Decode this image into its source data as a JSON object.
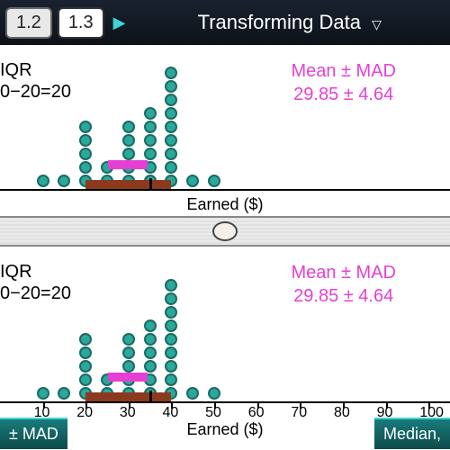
{
  "topbar": {
    "tabs": [
      "1.2",
      "1.3"
    ],
    "active_tab": 1,
    "title": "Transforming Data"
  },
  "chart_data": [
    {
      "type": "dotplot",
      "title_left_line1": "IQR",
      "title_left_line2": "0−20=20",
      "title_right_line1": "Mean ± MAD",
      "title_right_line2": "29.85 ± 4.64",
      "xlabel": "Earned ($)",
      "xlim": [
        0,
        105
      ],
      "stacks": [
        {
          "x": 10,
          "count": 1
        },
        {
          "x": 15,
          "count": 1
        },
        {
          "x": 20,
          "count": 5
        },
        {
          "x": 25,
          "count": 2
        },
        {
          "x": 30,
          "count": 5
        },
        {
          "x": 35,
          "count": 6
        },
        {
          "x": 40,
          "count": 9
        },
        {
          "x": 45,
          "count": 1
        },
        {
          "x": 50,
          "count": 1
        }
      ],
      "iqr_box": {
        "from": 20,
        "to": 40
      },
      "mad_box": {
        "from": 25.21,
        "to": 34.49
      },
      "median_mark": 35,
      "mean_mark": 29.85
    },
    {
      "type": "dotplot",
      "title_left_line1": "IQR",
      "title_left_line2": "0−20=20",
      "title_right_line1": "Mean ± MAD",
      "title_right_line2": "29.85 ± 4.64",
      "xlabel": "Earned ($)",
      "xlim": [
        0,
        105
      ],
      "ticks": [
        "10",
        "20",
        "30",
        "40",
        "50",
        "60",
        "70",
        "80",
        "90",
        "100"
      ],
      "stacks": [
        {
          "x": 10,
          "count": 1
        },
        {
          "x": 15,
          "count": 1
        },
        {
          "x": 20,
          "count": 5
        },
        {
          "x": 25,
          "count": 2
        },
        {
          "x": 30,
          "count": 5
        },
        {
          "x": 35,
          "count": 6
        },
        {
          "x": 40,
          "count": 9
        },
        {
          "x": 45,
          "count": 1
        },
        {
          "x": 50,
          "count": 1
        }
      ],
      "iqr_box": {
        "from": 20,
        "to": 40
      },
      "mad_box": {
        "from": 25.21,
        "to": 34.49
      },
      "median_mark": 35,
      "mean_mark": 29.85
    }
  ],
  "bottombar": {
    "left_button": "± MAD",
    "right_button": "Median,"
  }
}
